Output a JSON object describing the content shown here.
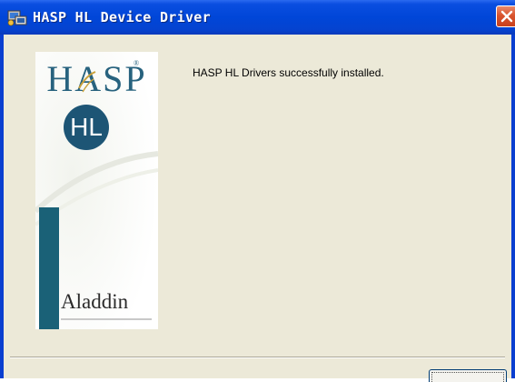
{
  "window": {
    "title": "HASP HL Device Driver",
    "title_icon": "hasp-driver-app-icon",
    "close_icon": "close-x-icon",
    "colors": {
      "titlebar": "#0046d8",
      "close_button": "#d9542e",
      "client_bg": "#ece9d8"
    }
  },
  "banner": {
    "product_word": "HASP",
    "product_mark": "®",
    "badge_text": "HL",
    "company": "Aladdin",
    "logo_icon": "aladdin-hasp-hl-logo",
    "colors": {
      "brand_teal": "#1a6177",
      "badge": "#1d5575"
    }
  },
  "message": "HASP HL Drivers successfully installed.",
  "buttons": {
    "finish_label": ""
  }
}
